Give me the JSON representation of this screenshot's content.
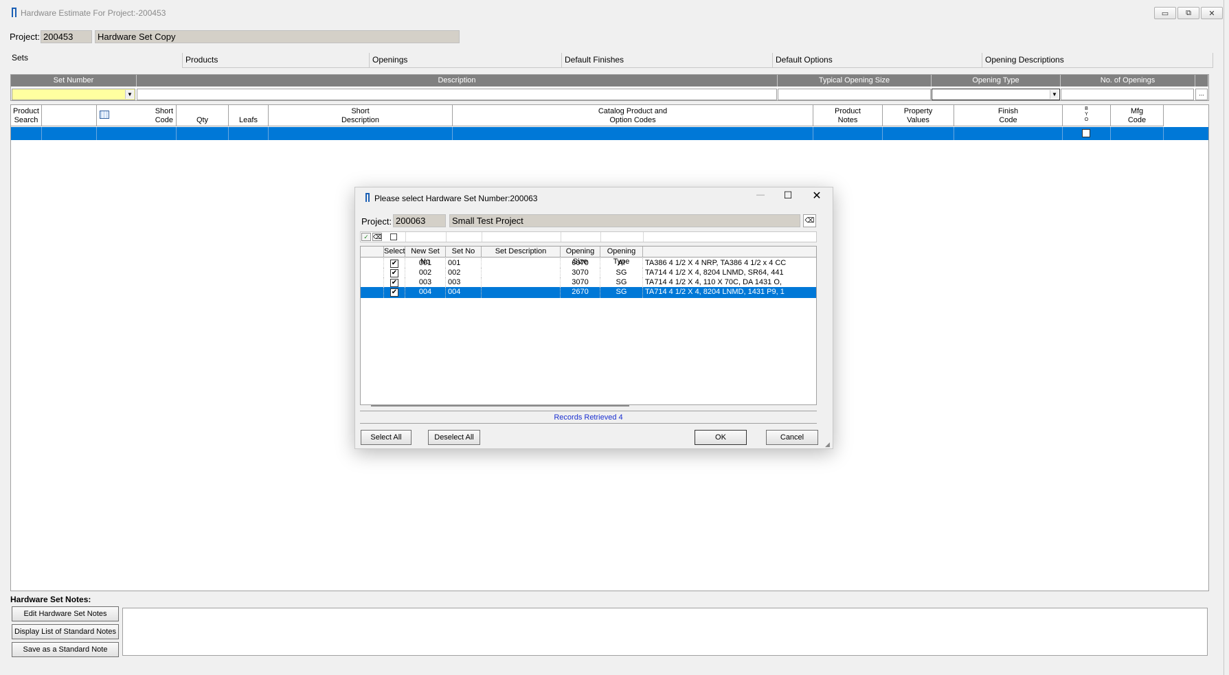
{
  "window": {
    "title": "Hardware Estimate For Project:-200453",
    "minimize": "▭",
    "restore": "⧉",
    "close": "✕"
  },
  "project": {
    "label": "Project:",
    "number": "200453",
    "name": "Hardware Set Copy"
  },
  "tabs": [
    "Sets",
    "Products",
    "Openings",
    "Default Finishes",
    "Default Options",
    "Opening Descriptions"
  ],
  "set_grid": {
    "headers": [
      "Set Number",
      "Description",
      "Typical Opening Size",
      "Opening Type",
      "No. of Openings"
    ],
    "ellipsis": "..."
  },
  "product_grid": {
    "headers": [
      {
        "l1": "Product",
        "l2": "Search"
      },
      {
        "l1": "",
        "l2": ""
      },
      {
        "l1": "Short",
        "l2": "Code"
      },
      {
        "l1": "",
        "l2": "Qty"
      },
      {
        "l1": "",
        "l2": "Leafs"
      },
      {
        "l1": "Short",
        "l2": "Description"
      },
      {
        "l1": "Catalog Product and",
        "l2": "Option Codes"
      },
      {
        "l1": "Product",
        "l2": "Notes"
      },
      {
        "l1": "Property",
        "l2": "Values"
      },
      {
        "l1": "Finish",
        "l2": "Code"
      },
      {
        "l1": "B Y O",
        "l2": ""
      },
      {
        "l1": "Mfg",
        "l2": "Code"
      }
    ]
  },
  "notes": {
    "label": "Hardware Set Notes:",
    "edit_button": "Edit Hardware Set Notes",
    "display_button": "Display List of Standard Notes",
    "save_button": "Save as a Standard Note"
  },
  "dialog": {
    "title": "Please select Hardware Set Number:200063",
    "project_label": "Project:",
    "project_number": "200063",
    "project_name": "Small Test Project",
    "headers": [
      "",
      "Select",
      "New Set No",
      "Set No",
      "Set Description",
      "Opening Size",
      "Opening Type",
      ""
    ],
    "rows": [
      {
        "checked": true,
        "new_set_no": "001",
        "set_no": "001",
        "description": "",
        "opening_size": "6070",
        "opening_type": "AI",
        "products": "TA386 4 1/2 X 4 NRP, TA386 4 1/2 x 4 CC",
        "selected": false
      },
      {
        "checked": true,
        "new_set_no": "002",
        "set_no": "002",
        "description": "",
        "opening_size": "3070",
        "opening_type": "SG",
        "products": "TA714 4 1/2 X 4, 8204 LNMD, SR64, 441",
        "selected": false
      },
      {
        "checked": true,
        "new_set_no": "003",
        "set_no": "003",
        "description": "",
        "opening_size": "3070",
        "opening_type": "SG",
        "products": "TA714 4 1/2 X 4, 110 X 70C, DA 1431 O,",
        "selected": false
      },
      {
        "checked": true,
        "new_set_no": "004",
        "set_no": "004",
        "description": "",
        "opening_size": "2670",
        "opening_type": "SG",
        "products": "TA714 4 1/2 X 4, 8204 LNMD, 1431 P9, 1",
        "selected": true
      }
    ],
    "status": "Records Retrieved 4",
    "select_all": "Select All",
    "deselect_all": "Deselect All",
    "ok": "OK",
    "cancel": "Cancel",
    "check_mark": "✔"
  }
}
